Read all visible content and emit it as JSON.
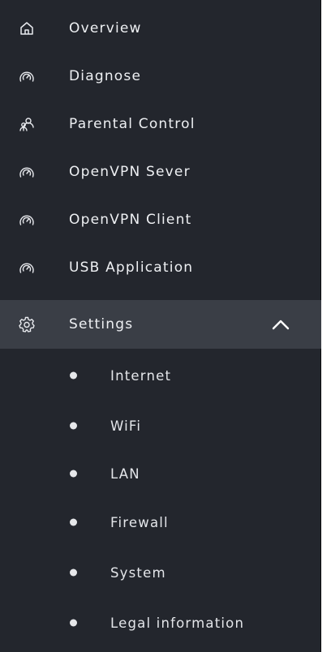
{
  "sidebar": {
    "items": [
      {
        "label": "Overview",
        "icon": "home-icon"
      },
      {
        "label": "Diagnose",
        "icon": "gauge-icon"
      },
      {
        "label": "Parental Control",
        "icon": "parental-icon"
      },
      {
        "label": "OpenVPN Sever",
        "icon": "gauge-icon"
      },
      {
        "label": "OpenVPN Client",
        "icon": "gauge-icon"
      },
      {
        "label": "USB Application",
        "icon": "gauge-icon"
      },
      {
        "label": "Settings",
        "icon": "gear-icon",
        "expanded": true,
        "chevron": "chevron-up-icon"
      }
    ],
    "settings_submenu": [
      {
        "label": "Internet"
      },
      {
        "label": "WiFi"
      },
      {
        "label": "LAN"
      },
      {
        "label": "Firewall"
      },
      {
        "label": "System"
      },
      {
        "label": "Legal information"
      }
    ]
  },
  "colors": {
    "panel_bg": "#23262d",
    "active_bg": "#3a3e46",
    "text": "#eef0f3"
  }
}
